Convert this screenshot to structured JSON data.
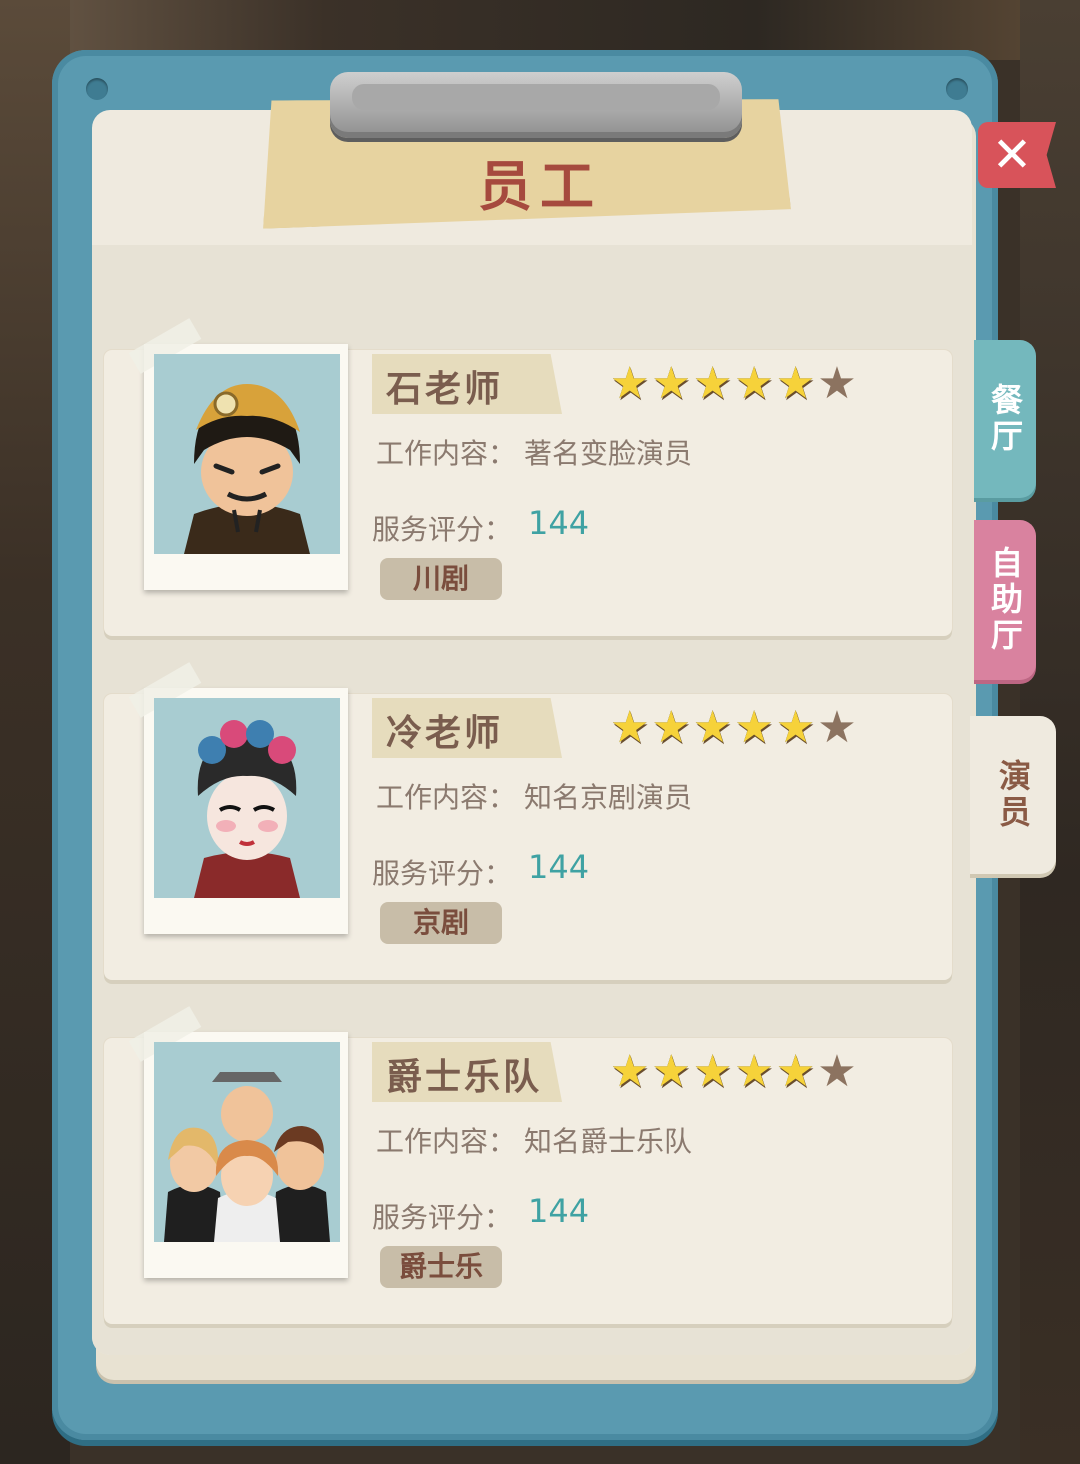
{
  "header": {
    "title": "员工"
  },
  "close": {
    "label": "✕"
  },
  "tabs": [
    {
      "label": "餐厅",
      "color": "#74b8bd"
    },
    {
      "label": "自助厅",
      "color": "#d9829f"
    },
    {
      "label": "演员",
      "active": true
    }
  ],
  "employees": [
    {
      "name": "石老师",
      "stars_filled": 5,
      "stars_total": 6,
      "work_label": "工作内容：",
      "work": "著名变脸演员",
      "score_label": "服务评分：",
      "score": "144",
      "tag": "川剧"
    },
    {
      "name": "冷老师",
      "stars_filled": 5,
      "stars_total": 6,
      "work_label": "工作内容：",
      "work": "知名京剧演员",
      "score_label": "服务评分：",
      "score": "144",
      "tag": "京剧"
    },
    {
      "name": "爵士乐队",
      "stars_filled": 5,
      "stars_total": 6,
      "work_label": "工作内容：",
      "work": "知名爵士乐队",
      "score_label": "服务评分：",
      "score": "144",
      "tag": "爵士乐"
    }
  ],
  "colors": {
    "accent": "#3fa2a3",
    "title": "#a64a3e",
    "star_on": "#f6d23a",
    "star_off": "#8c7360"
  }
}
